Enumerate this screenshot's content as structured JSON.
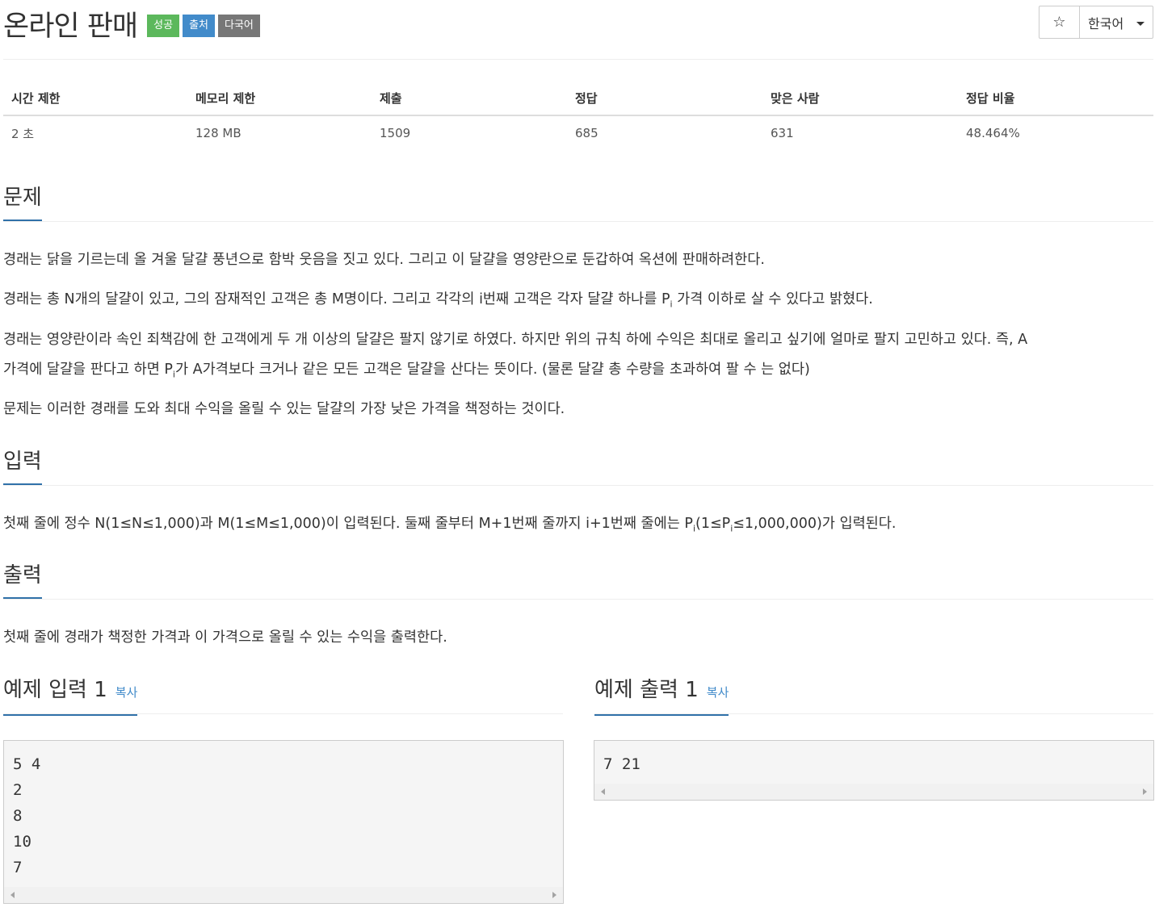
{
  "title": "온라인 판매",
  "labels": {
    "success": "성공",
    "source": "출처",
    "multilang": "다국어"
  },
  "toolbar": {
    "star": "☆",
    "language": "한국어"
  },
  "stats": {
    "headers": [
      "시간 제한",
      "메모리 제한",
      "제출",
      "정답",
      "맞은 사람",
      "정답 비율"
    ],
    "values": [
      "2 초",
      "128 MB",
      "1509",
      "685",
      "631",
      "48.464%"
    ]
  },
  "problem": {
    "heading": "문제",
    "p1": "경래는 닭을 기르는데 올 겨울 달걀 풍년으로 함박 웃음을 짓고 있다. 그리고 이 달걀을 영양란으로 둔갑하여 옥션에 판매하려한다.",
    "p2_a": "경래는 총 N개의 달걀이 있고, 그의 잠재적인 고객은 총 M명이다. 그리고 각각의 i번째 고객은 각자 달걀 하나를 P",
    "p2_sub": "i",
    "p2_b": " 가격 이하로 살 수 있다고 밝혔다.",
    "p3_a": "경래는 영양란이라 속인 죄책감에 한 고객에게 두 개 이상의 달걀은 팔지 않기로 하였다. 하지만 위의 규칙 하에 수익은 최대로 올리고 싶기에 얼마로 팔지 고민하고 있다. 즉, A",
    "p3_b": "가격에 달걀을 판다고 하면 P",
    "p3_sub": "i",
    "p3_c": "가 A가격보다 크거나 같은 모든 고객은 달걀을 산다는 뜻이다. (물론 달걀 총 수량을 초과하여 팔 수 는 없다)",
    "p4": "문제는 이러한 경래를 도와 최대 수익을 올릴 수 있는 달걀의 가장 낮은 가격을 책정하는 것이다."
  },
  "input": {
    "heading": "입력",
    "text_a": "첫째 줄에 정수 N(1≤N≤1,000)과 M(1≤M≤1,000)이 입력된다. 둘째 줄부터 M+1번째 줄까지 i+1번째 줄에는 P",
    "sub1": "i",
    "text_b": "(1≤P",
    "sub2": "i",
    "text_c": "≤1,000,000)가 입력된다."
  },
  "output": {
    "heading": "출력",
    "text": "첫째 줄에 경래가 책정한 가격과 이 가격으로 올릴 수 있는 수익을 출력한다."
  },
  "sample_input": {
    "heading": "예제 입력 1",
    "copy": "복사",
    "content": "5 4\n2\n8\n10\n7"
  },
  "sample_output": {
    "heading": "예제 출력 1",
    "copy": "복사",
    "content": "7 21"
  }
}
